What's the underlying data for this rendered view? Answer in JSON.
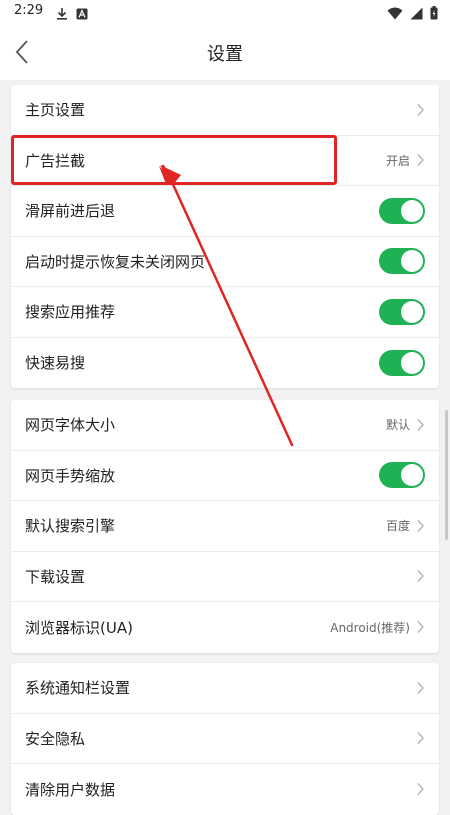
{
  "status_bar": {
    "time": "2:29"
  },
  "header": {
    "title": "设置"
  },
  "groups": [
    {
      "items": [
        {
          "label": "主页设置",
          "control": "chevron"
        },
        {
          "label": "广告拦截",
          "value": "开启",
          "control": "chevron"
        },
        {
          "label": "滑屏前进后退",
          "control": "toggle",
          "checked": true
        },
        {
          "label": "启动时提示恢复未关闭网页",
          "control": "toggle",
          "checked": true
        },
        {
          "label": "搜索应用推荐",
          "control": "toggle",
          "checked": true
        },
        {
          "label": "快速易搜",
          "control": "toggle",
          "checked": true
        }
      ]
    },
    {
      "items": [
        {
          "label": "网页字体大小",
          "value": "默认",
          "control": "chevron"
        },
        {
          "label": "网页手势缩放",
          "control": "toggle",
          "checked": true
        },
        {
          "label": "默认搜索引擎",
          "value": "百度",
          "control": "chevron"
        },
        {
          "label": "下载设置",
          "control": "chevron"
        },
        {
          "label": "浏览器标识(UA)",
          "value": "Android(推荐)",
          "control": "chevron"
        }
      ]
    },
    {
      "items": [
        {
          "label": "系统通知栏设置",
          "control": "chevron"
        },
        {
          "label": "安全隐私",
          "control": "chevron"
        },
        {
          "label": "清除用户数据",
          "control": "chevron"
        }
      ]
    }
  ],
  "colors": {
    "toggle_on": "#1fb254",
    "annotation": "#e02525"
  },
  "icons": [
    "download-icon",
    "app-a-icon",
    "wifi-icon",
    "signal-icon",
    "battery-icon",
    "back-arrow-icon",
    "chevron-right-icon"
  ]
}
